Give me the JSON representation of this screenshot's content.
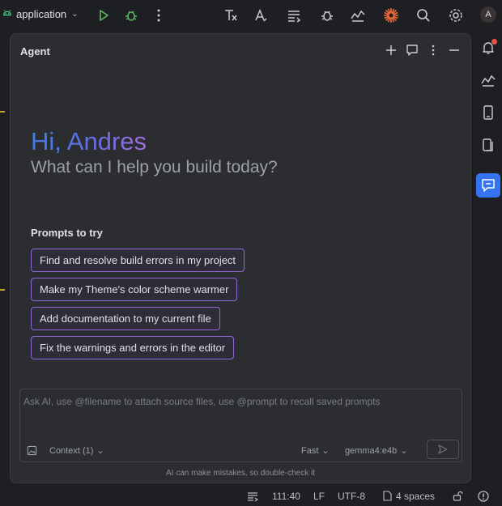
{
  "topbar": {
    "project_name": "application",
    "avatar_initial": "A",
    "accent_color": "#f26b3a"
  },
  "agent_panel": {
    "title": "Agent",
    "greeting": "Hi, Andres",
    "subtitle": "What can I help you build today?",
    "prompts_heading": "Prompts to try",
    "prompts": [
      "Find and resolve build errors in my project",
      "Make my Theme's color scheme warmer",
      "Add documentation to my current file",
      "Fix the warnings and errors in the editor"
    ],
    "input": {
      "placeholder": "Ask AI, use @filename to attach source files, use @prompt to recall saved prompts",
      "context_label": "Context (1)",
      "speed_label": "Fast",
      "model_label": "gemma4:e4b"
    },
    "disclaimer": "AI can make mistakes, so double-check it"
  },
  "statusbar": {
    "position": "111:40",
    "line_ending": "LF",
    "encoding": "UTF-8",
    "indent": "4 spaces"
  }
}
